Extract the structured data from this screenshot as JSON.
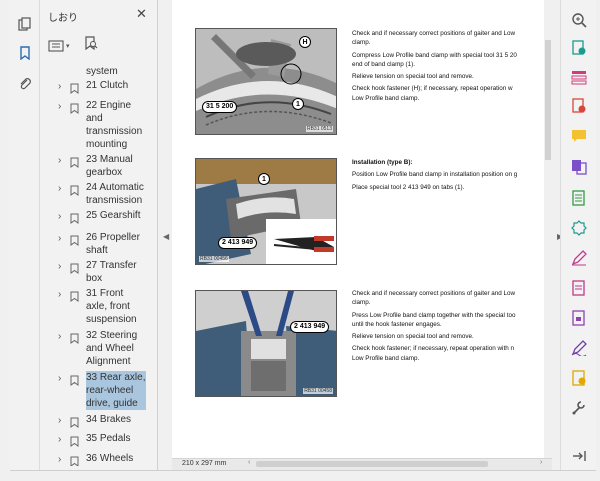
{
  "panel": {
    "title": "しおり",
    "close_label": "✕"
  },
  "tree": {
    "items": [
      {
        "label": "system",
        "chevron": false
      },
      {
        "label": "21 Clutch",
        "chevron": true
      },
      {
        "label": "22 Engine and transmission mounting",
        "chevron": true
      },
      {
        "label": "23 Manual gearbox",
        "chevron": true
      },
      {
        "label": "24 Automatic transmission",
        "chevron": true
      },
      {
        "label": "25 Gearshift",
        "chevron": true
      },
      {
        "label": "26 Propeller shaft",
        "chevron": true
      },
      {
        "label": "27 Transfer box",
        "chevron": true
      },
      {
        "label": "31 Front axle, front suspension",
        "chevron": true
      },
      {
        "label": "32 Steering and Wheel Alignment",
        "chevron": true
      },
      {
        "label": "33 Rear axle, rear-wheel drive, guide",
        "chevron": true
      },
      {
        "label": "34 Brakes",
        "chevron": true
      },
      {
        "label": "35 Pedals",
        "chevron": true
      },
      {
        "label": "36 Wheels",
        "chevron": true
      }
    ],
    "selected_index": 10
  },
  "document": {
    "figure1": {
      "callouts": [
        "H",
        "31 5 200",
        "1"
      ],
      "id": "RB31 0513"
    },
    "figure2": {
      "callouts": [
        "1",
        "2 413 949"
      ],
      "id": "RB31 00456"
    },
    "figure3": {
      "callouts": [
        "2 413 949"
      ],
      "id": "RB31 00458"
    },
    "block1": [
      "Check and if necessary correct positions of gaiter and Low",
      "clamp.",
      "Compress Low Profile band clamp with special tool 31 5 20",
      "end of band clamp (1).",
      "Relieve tension on special tool and remove.",
      "Check hook fastener (H); if necessary, repeat operation w",
      "Low Profile band clamp."
    ],
    "block2_heading": "Installation (type B):",
    "block2": [
      "Position Low Profile band clamp in installation position on g",
      "Place special tool 2 413 949 on tabs (1)."
    ],
    "block3": [
      "Check and if necessary correct positions of gaiter and Low",
      "clamp.",
      "Press Low Profile band clamp together with the special too",
      "until the hook fastener engages.",
      "Relieve tension on special tool and remove.",
      "Check hook fastener; if necessary, repeat operation with n",
      "Low Profile band clamp."
    ]
  },
  "status": {
    "page_size": "210 x 297 mm"
  },
  "colors": {
    "selected_bg": "#a9c6de",
    "accent_blue": "#2b6cb0"
  },
  "tools": [
    "zoom-icon",
    "export-pdf-icon",
    "organize-pages-icon",
    "create-pdf-icon",
    "comment-icon",
    "combine-files-icon",
    "excel-export-icon",
    "enhance-scan-icon",
    "fill-sign-icon",
    "edit-pdf-icon",
    "protect-icon",
    "sign-icon",
    "send-review-icon",
    "more-tools-icon",
    "collapse-pane-icon"
  ]
}
